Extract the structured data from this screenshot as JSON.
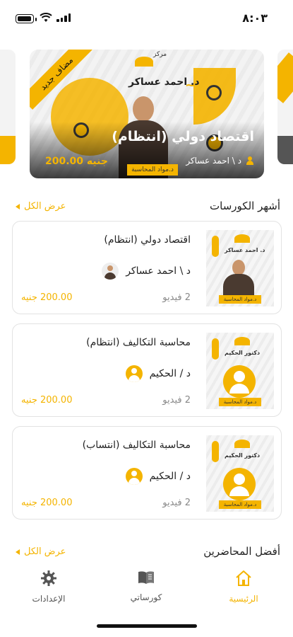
{
  "status_bar": {
    "time": "٨:٠٣"
  },
  "hero": {
    "ribbon": "مضاف جديد",
    "logo_text": "مركز",
    "instructor_banner": "د. احمد عساكر",
    "title": "اقتصاد دولي (انتظام)",
    "instructor": "د \\ احمد عساكر",
    "price": "200.00 جنيه",
    "strip_label": "د.مواد المحاسبة"
  },
  "sections": {
    "popular_courses": {
      "title": "أشهر الكورسات",
      "see_all": "عرض الكل"
    },
    "best_lecturers": {
      "title": "أفضل المحاضرين",
      "see_all": "عرض الكل"
    }
  },
  "courses": [
    {
      "title": "اقتصاد دولي (انتظام)",
      "instructor": "د \\ احمد عساكر",
      "videos": "2 فيديو",
      "price": "200.00 جنيه",
      "thumb_name": "د. احمد عساكر",
      "thumb_strip": "د.مواد المحاسبة"
    },
    {
      "title": "محاسبة التكاليف (انتظام)",
      "instructor": "د / الحكيم",
      "videos": "2 فيديو",
      "price": "200.00 جنيه",
      "thumb_name": "دكتور الحكيم",
      "thumb_strip": "د.مواد المحاسبة"
    },
    {
      "title": "محاسبة التكاليف (انتساب)",
      "instructor": "د / الحكيم",
      "videos": "2 فيديو",
      "price": "200.00 جنيه",
      "thumb_name": "دكتور الحكيم",
      "thumb_strip": "د.مواد المحاسبة"
    }
  ],
  "nav": {
    "home": "الرئيسية",
    "my_courses": "كورساتي",
    "settings": "الإعدادات"
  },
  "colors": {
    "accent": "#f4b400",
    "text": "#222222",
    "muted": "#888888"
  }
}
